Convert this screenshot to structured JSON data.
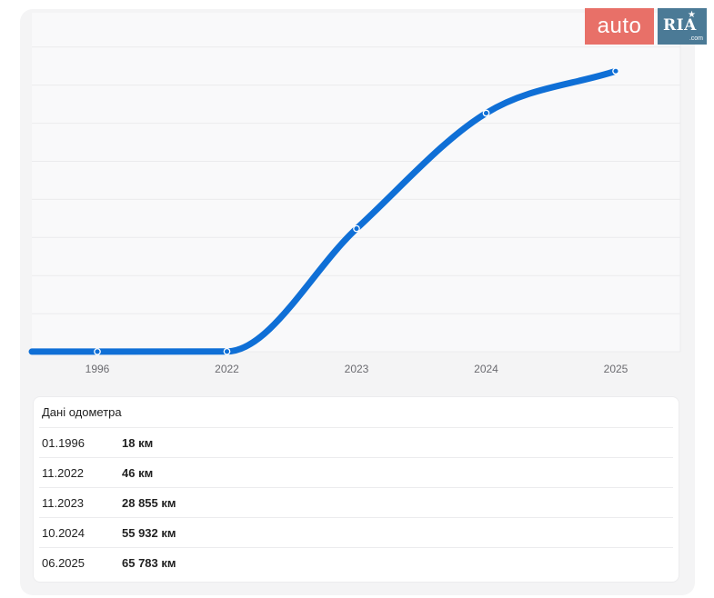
{
  "brand": {
    "auto_text": "auto",
    "ria_text": "RIA",
    "ria_suffix": ".com",
    "auto_color": "#e87068",
    "ria_color": "#4b7a96"
  },
  "chart_data": {
    "type": "line",
    "title": "",
    "xlabel": "",
    "ylabel": "",
    "categories": [
      "1996",
      "2022",
      "2023",
      "2024",
      "2025"
    ],
    "series": [
      {
        "values": [
          18,
          46,
          28855,
          55932,
          65783
        ]
      }
    ],
    "ylim": [
      0,
      75000
    ],
    "grid": true,
    "line_color": "#0f6fd6",
    "plot_background": "#f9f9fa"
  },
  "odometer": {
    "title": "Дані одометра",
    "rows": [
      {
        "date": "01.1996",
        "value": "18 км"
      },
      {
        "date": "11.2022",
        "value": "46 км"
      },
      {
        "date": "11.2023",
        "value": "28 855 км"
      },
      {
        "date": "10.2024",
        "value": "55 932 км"
      },
      {
        "date": "06.2025",
        "value": "65 783 км"
      }
    ]
  }
}
